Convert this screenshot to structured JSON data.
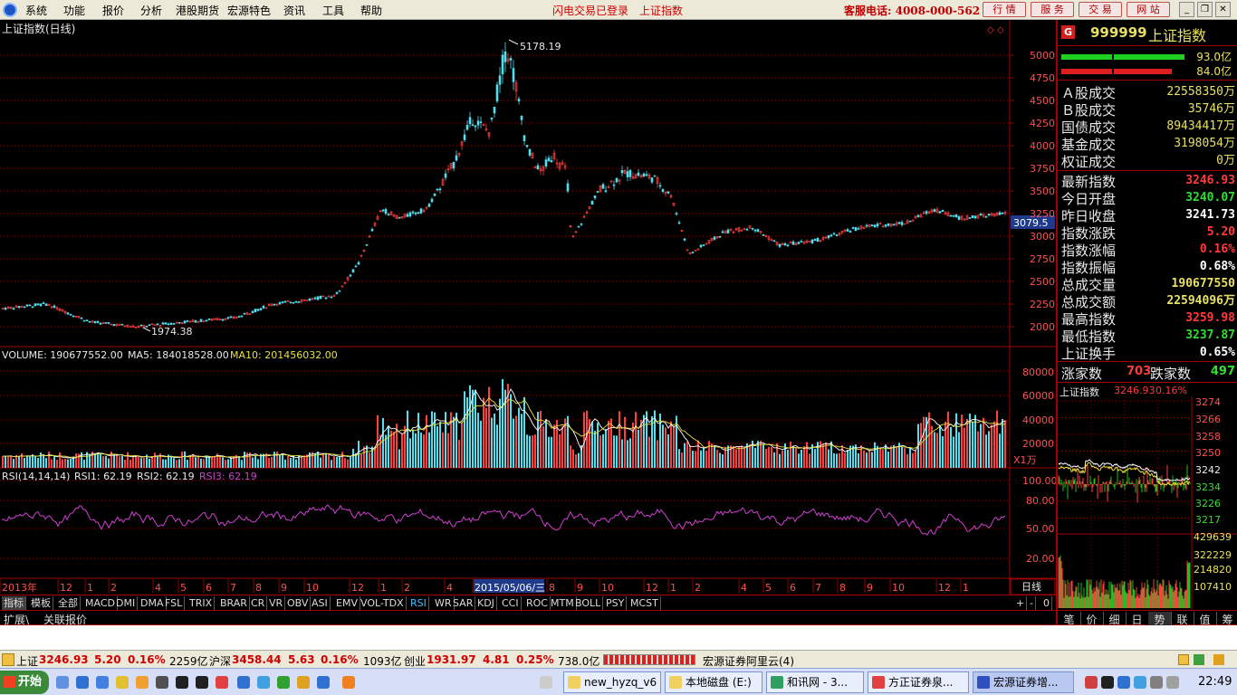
{
  "menu": {
    "items": [
      "系统",
      "功能",
      "报价",
      "分析",
      "港股期货",
      "宏源特色",
      "资讯",
      "工具",
      "帮助"
    ],
    "status_left": "闪电交易已登录",
    "status_right": "上证指数",
    "hotline": "客服电话: 4008-000-562",
    "quick_buttons": [
      "行 情",
      "服 务",
      "交 易",
      "网 站"
    ]
  },
  "kline": {
    "title": "上证指数(日线)",
    "y_ticks": [
      "5000",
      "4750",
      "4500",
      "4250",
      "4000",
      "3750",
      "3500",
      "3250",
      "3000",
      "2750",
      "2500",
      "2250",
      "2000"
    ],
    "high_label": "5178.19",
    "low_label": "1974.38",
    "current_label": "3079.5",
    "corner_icons": "◇ ◇"
  },
  "volume": {
    "label_vol": "VOLUME: 190677552.00",
    "label_ma5": "MA5: 184018528.00",
    "label_ma10": "MA10: 201456032.00",
    "y_ticks": [
      "80000",
      "60000",
      "40000",
      "20000"
    ],
    "unit": "X1万"
  },
  "rsi": {
    "label_head": "RSI(14,14,14)",
    "label_rsi1": "RSI1: 62.19",
    "label_rsi2": "RSI2: 62.19",
    "label_rsi3": "RSI3: 62.19",
    "y_ticks": [
      "100.00",
      "80.00",
      "50.00",
      "20.00"
    ]
  },
  "time_axis": {
    "labels": [
      "2013年",
      "12",
      "1",
      "2",
      "4",
      "5",
      "6",
      "7",
      "8",
      "9",
      "10",
      "12",
      "1",
      "2",
      "4",
      "2015/05/06/三",
      "8",
      "9",
      "10",
      "12",
      "1",
      "2",
      "4",
      "5",
      "6",
      "7",
      "8",
      "9",
      "10",
      "12",
      "1"
    ],
    "period": "日线"
  },
  "indicator_tabs": [
    "指标",
    "模板",
    "全部",
    "MACD",
    "DMI",
    "DMA",
    "FSL",
    "TRIX",
    "BRAR",
    "CR",
    "VR",
    "OBV",
    "ASI",
    "EMV",
    "VOL-TDX",
    "RSI",
    "WR",
    "SAR",
    "KDJ",
    "CCI",
    "ROC",
    "MTM",
    "BOLL",
    "PSY",
    "MCST"
  ],
  "zoom_controls": [
    "+",
    "-",
    "0"
  ],
  "ext_tabs": [
    "扩展\\",
    "关联报价"
  ],
  "right_tabs": [
    "笔",
    "价",
    "细",
    "日",
    "势",
    "联",
    "值",
    "筹"
  ],
  "quote": {
    "badge": "G",
    "code": "999999",
    "name": "上证指数",
    "bar_top_value": "93.0亿",
    "bar_bottom_value": "84.0亿",
    "top_rows": [
      {
        "label": "Ａ股成交",
        "value": "22558350万"
      },
      {
        "label": "Ｂ股成交",
        "value": "35746万"
      },
      {
        "label": "国债成交",
        "value": "89434417万"
      },
      {
        "label": "基金成交",
        "value": "3198054万"
      },
      {
        "label": "权证成交",
        "value": "0万"
      }
    ],
    "rows": [
      {
        "label": "最新指数",
        "value": "3246.93",
        "color": "#ff3a3a"
      },
      {
        "label": "今日开盘",
        "value": "3240.07",
        "color": "#33dd33"
      },
      {
        "label": "昨日收盘",
        "value": "3241.73",
        "color": "#ffffff"
      },
      {
        "label": "指数涨跌",
        "value": "5.20",
        "color": "#ff3a3a"
      },
      {
        "label": "指数涨幅",
        "value": "0.16%",
        "color": "#ff3a3a"
      },
      {
        "label": "指数振幅",
        "value": "0.68%",
        "color": "#ffffff"
      },
      {
        "label": "总成交量",
        "value": "190677550",
        "color": "#e8e060"
      },
      {
        "label": "总成交额",
        "value": "22594096万",
        "color": "#e8e060"
      },
      {
        "label": "最高指数",
        "value": "3259.98",
        "color": "#ff3a3a"
      },
      {
        "label": "最低指数",
        "value": "3237.87",
        "color": "#33dd33"
      },
      {
        "label": "上证换手",
        "value": "0.65%",
        "color": "#ffffff"
      }
    ],
    "up_label": "涨家数",
    "up_count": "703",
    "down_label": "跌家数",
    "down_count": "497"
  },
  "mini": {
    "name": "上证指数",
    "price": "3246.93",
    "change": "0.16%",
    "price_ticks": [
      "3274",
      "3266",
      "3258",
      "3250",
      "3242",
      "3234",
      "3226",
      "3217"
    ],
    "vol_ticks": [
      "429639",
      "322229",
      "214820",
      "107410"
    ]
  },
  "status": {
    "sh_label": "上证",
    "sh_value": "3246.93",
    "sh_change": "5.20",
    "sh_pct": "0.16%",
    "sh_amount": "2259亿",
    "hs_label": "沪深",
    "hs_value": "3458.44",
    "hs_change": "5.63",
    "hs_pct": "0.16%",
    "hs_amount": "1093亿",
    "cy_label": "创业",
    "cy_value": "1931.97",
    "cy_change": "4.81",
    "cy_pct": "0.25%",
    "cy_amount": "738.0亿",
    "broker": "宏源证券阿里云(4)"
  },
  "taskbar": {
    "start": "开始",
    "windows": [
      "new_hyzq_v6",
      "本地磁盘 (E:)",
      "和讯网 - 3...",
      "方正证券泉...",
      "宏源证券增..."
    ],
    "clock": "22:49"
  },
  "colors": {
    "up": "#ff4040",
    "down": "#50e0f0",
    "grid": "#8b0000",
    "ma5": "#ffffff",
    "ma10": "#e8e040",
    "rsi": "#d040d0"
  }
}
